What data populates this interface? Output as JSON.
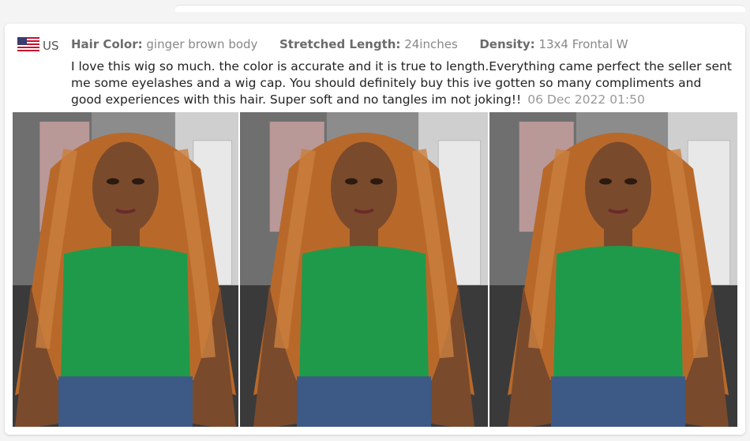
{
  "reviewer": {
    "country": "US",
    "flag_icon": "us-flag-icon"
  },
  "attributes": [
    {
      "key": "Hair Color:",
      "value": "ginger brown body"
    },
    {
      "key": "Stretched Length:",
      "value": "24inches"
    },
    {
      "key": "Density:",
      "value": "13x4 Frontal W"
    }
  ],
  "review": {
    "text": "I love this wig so much. the color is accurate and it is true to length.Everything came perfect the seller sent me some eyelashes and a wig cap. You should definitely buy this ive gotten so many compliments and good experiences with this hair. Super soft and no tangles im not joking!!",
    "date": "06 Dec 2022 01:50"
  },
  "photos": [
    {
      "name": "review-photo-1"
    },
    {
      "name": "review-photo-2"
    },
    {
      "name": "review-photo-3"
    }
  ],
  "colors": {
    "hair": "#b8692a",
    "top": "#1f9a4a",
    "jeans": "#3d5a86",
    "skin": "#7a4a2c",
    "wall": "#cfcfcf"
  }
}
